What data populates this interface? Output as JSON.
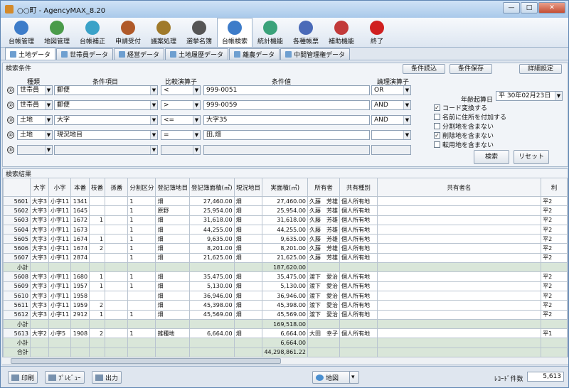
{
  "window": {
    "title": "○○町 - AgencyMAX_8.20"
  },
  "toolbar": [
    {
      "label": "台帳管理",
      "color": "#3d7cc9"
    },
    {
      "label": "地図管理",
      "color": "#4a9b4a"
    },
    {
      "label": "台帳補正",
      "color": "#3aa2c8"
    },
    {
      "label": "申請受付",
      "color": "#b05a2a"
    },
    {
      "label": "議案処理",
      "color": "#a07a2a"
    },
    {
      "label": "選挙名簿",
      "color": "#555555"
    },
    {
      "label": "台帳検索",
      "color": "#3d7cc9"
    },
    {
      "label": "統計機能",
      "color": "#3aa27a"
    },
    {
      "label": "各種帳票",
      "color": "#4a6ab8"
    },
    {
      "label": "補助機能",
      "color": "#c23a3a"
    },
    {
      "label": "終了",
      "color": "#d02020"
    }
  ],
  "tabs": [
    "土地データ",
    "世帯員データ",
    "経営データ",
    "土地履歴データ",
    "離農データ",
    "中間管理権データ"
  ],
  "cond": {
    "header": "検索条件",
    "btn_load": "条件読込",
    "btn_save": "条件保存",
    "btn_detail": "詳細設定",
    "col_kind": "種類",
    "col_item": "条件項目",
    "col_cmp": "比較演算子",
    "col_value": "条件値",
    "col_logic": "論理演算子",
    "rows": [
      {
        "num": "①",
        "kind": "世帯員",
        "item": "郵便",
        "cmp": "<",
        "value": "999-0051",
        "logic": "OR"
      },
      {
        "num": "②",
        "kind": "世帯員",
        "item": "郵便",
        "cmp": ">",
        "value": "999-0059",
        "logic": "AND"
      },
      {
        "num": "③",
        "kind": "土地",
        "item": "大字",
        "cmp": "<=",
        "value": "大字35",
        "logic": "AND"
      },
      {
        "num": "④",
        "kind": "土地",
        "item": "現況地目",
        "cmp": "=",
        "value": "田,畑",
        "logic": ""
      },
      {
        "num": "⑤",
        "kind": "",
        "item": "",
        "cmp": "",
        "value": "",
        "logic": ""
      }
    ],
    "date_label": "年齢起算日",
    "date_value": "平 30年02月23日",
    "options": [
      {
        "label": "コード変換する",
        "checked": true
      },
      {
        "label": "名前に住所を付加する",
        "checked": false
      },
      {
        "label": "分割地を含まない",
        "checked": false
      },
      {
        "label": "削除地を含まない",
        "checked": true
      },
      {
        "label": "転用地を含まない",
        "checked": false
      }
    ],
    "btn_search": "検索",
    "btn_reset": "リセット"
  },
  "results": {
    "header": "検索結果",
    "columns": [
      "",
      "大字",
      "小字",
      "本番",
      "枝番",
      "孫番",
      "分割区分",
      "登記簿地目",
      "登記簿面積(㎡)",
      "現況地目",
      "実面積(㎡)",
      "所有者",
      "共有種別",
      "共有者名",
      "利"
    ],
    "rows": [
      [
        "5601",
        "大字3",
        "小字11",
        "1341",
        "",
        "",
        "1",
        "畑",
        "27,460.00",
        "畑",
        "27,460.00",
        "久藤　芳雄",
        "個人所有地",
        "",
        "平2"
      ],
      [
        "5602",
        "大字3",
        "小字11",
        "1645",
        "",
        "",
        "1",
        "原野",
        "25,954.00",
        "畑",
        "25,954.00",
        "久藤　芳雄",
        "個人所有地",
        "",
        "平2"
      ],
      [
        "5603",
        "大字3",
        "小字11",
        "1672",
        "1",
        "",
        "1",
        "畑",
        "31,618.00",
        "畑",
        "31,618.00",
        "久藤　芳雄",
        "個人所有地",
        "",
        "平2"
      ],
      [
        "5604",
        "大字3",
        "小字11",
        "1673",
        "",
        "",
        "1",
        "畑",
        "44,255.00",
        "畑",
        "44,255.00",
        "久藤　芳雄",
        "個人所有地",
        "",
        "平2"
      ],
      [
        "5605",
        "大字3",
        "小字11",
        "1674",
        "1",
        "",
        "1",
        "畑",
        "9,635.00",
        "畑",
        "9,635.00",
        "久藤　芳雄",
        "個人所有地",
        "",
        "平2"
      ],
      [
        "5606",
        "大字3",
        "小字11",
        "1674",
        "2",
        "",
        "1",
        "畑",
        "8,201.00",
        "畑",
        "8,201.00",
        "久藤　芳雄",
        "個人所有地",
        "",
        "平2"
      ],
      [
        "5607",
        "大字3",
        "小字11",
        "2874",
        "",
        "",
        "1",
        "畑",
        "21,625.00",
        "畑",
        "21,625.00",
        "久藤　芳雄",
        "個人所有地",
        "",
        "平2"
      ],
      [
        "小計",
        "",
        "",
        "",
        "",
        "",
        "",
        "",
        "",
        "",
        "187,620.00",
        "",
        "",
        "",
        ""
      ],
      [
        "5608",
        "大字3",
        "小字11",
        "1680",
        "1",
        "",
        "1",
        "畑",
        "35,475.00",
        "畑",
        "35,475.00",
        "渡下　愛治",
        "個人所有地",
        "",
        "平2"
      ],
      [
        "5609",
        "大字3",
        "小字11",
        "1957",
        "1",
        "",
        "1",
        "畑",
        "5,130.00",
        "畑",
        "5,130.00",
        "渡下　愛治",
        "個人所有地",
        "",
        "平2"
      ],
      [
        "5610",
        "大字3",
        "小字11",
        "1958",
        "",
        "",
        "",
        "畑",
        "36,946.00",
        "畑",
        "36,946.00",
        "渡下　愛治",
        "個人所有地",
        "",
        "平2"
      ],
      [
        "5611",
        "大字3",
        "小字11",
        "1959",
        "2",
        "",
        "",
        "畑",
        "45,398.00",
        "畑",
        "45,398.00",
        "渡下　愛治",
        "個人所有地",
        "",
        "平2"
      ],
      [
        "5612",
        "大字3",
        "小字11",
        "2912",
        "1",
        "",
        "1",
        "畑",
        "45,569.00",
        "畑",
        "45,569.00",
        "渡下　愛治",
        "個人所有地",
        "",
        "平2"
      ],
      [
        "小計",
        "",
        "",
        "",
        "",
        "",
        "",
        "",
        "",
        "",
        "169,518.00",
        "",
        "",
        "",
        ""
      ],
      [
        "5613",
        "大字2",
        "小字5",
        "1908",
        "2",
        "",
        "1",
        "雑種地",
        "6,664.00",
        "畑",
        "6,664.00",
        "大田　幸子",
        "個人所有地",
        "",
        "平1"
      ],
      [
        "小計",
        "",
        "",
        "",
        "",
        "",
        "",
        "",
        "",
        "",
        "6,664.00",
        "",
        "",
        "",
        ""
      ],
      [
        "合計",
        "",
        "",
        "",
        "",
        "",
        "",
        "",
        "",
        "",
        "44,298,861.22",
        "",
        "",
        "",
        ""
      ]
    ]
  },
  "statusbar": {
    "print": "印刷",
    "preview": "ﾌﾟﾚﾋﾞｭｰ",
    "output": "出力",
    "map": "地図",
    "count_label": "ﾚｺｰﾄﾞ件数",
    "count": "5,613"
  }
}
